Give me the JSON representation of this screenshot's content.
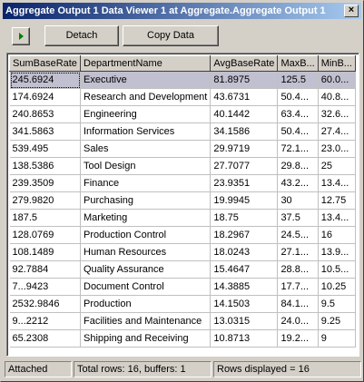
{
  "window": {
    "title": "Aggregate Output 1 Data Viewer 1 at Aggregate.Aggregate Output 1",
    "close_glyph": "×"
  },
  "toolbar": {
    "play_icon": "play-icon",
    "detach_label": "Detach",
    "copy_label": "Copy Data"
  },
  "grid": {
    "columns": [
      "SumBaseRate",
      "DepartmentName",
      "AvgBaseRate",
      "MaxB...",
      "MinB..."
    ],
    "selected_row": 0,
    "rows": [
      [
        "245.6924",
        "Executive",
        "81.8975",
        "125.5",
        "60.0..."
      ],
      [
        "174.6924",
        "Research and Development",
        "43.6731",
        "50.4...",
        "40.8..."
      ],
      [
        "240.8653",
        "Engineering",
        "40.1442",
        "63.4...",
        "32.6..."
      ],
      [
        "341.5863",
        "Information Services",
        "34.1586",
        "50.4...",
        "27.4..."
      ],
      [
        "539.495",
        "Sales",
        "29.9719",
        "72.1...",
        "23.0..."
      ],
      [
        "138.5386",
        "Tool Design",
        "27.7077",
        "29.8...",
        "25"
      ],
      [
        "239.3509",
        "Finance",
        "23.9351",
        "43.2...",
        "13.4..."
      ],
      [
        "279.9820",
        "Purchasing",
        "19.9945",
        "30",
        "12.75"
      ],
      [
        "187.5",
        "Marketing",
        "18.75",
        "37.5",
        "13.4..."
      ],
      [
        "128.0769",
        "Production Control",
        "18.2967",
        "24.5...",
        "16"
      ],
      [
        "108.1489",
        "Human Resources",
        "18.0243",
        "27.1...",
        "13.9..."
      ],
      [
        "92.7884",
        "Quality Assurance",
        "15.4647",
        "28.8...",
        "10.5..."
      ],
      [
        "7...9423",
        "Document Control",
        "14.3885",
        "17.7...",
        "10.25"
      ],
      [
        "2532.9846",
        "Production",
        "14.1503",
        "84.1...",
        "9.5"
      ],
      [
        "9...2212",
        "Facilities and Maintenance",
        "13.0315",
        "24.0...",
        "9.25"
      ],
      [
        "65.2308",
        "Shipping and Receiving",
        "10.8713",
        "19.2...",
        "9"
      ]
    ]
  },
  "status": {
    "state": "Attached",
    "totals": "Total rows: 16, buffers: 1",
    "displayed": "Rows displayed = 16"
  }
}
